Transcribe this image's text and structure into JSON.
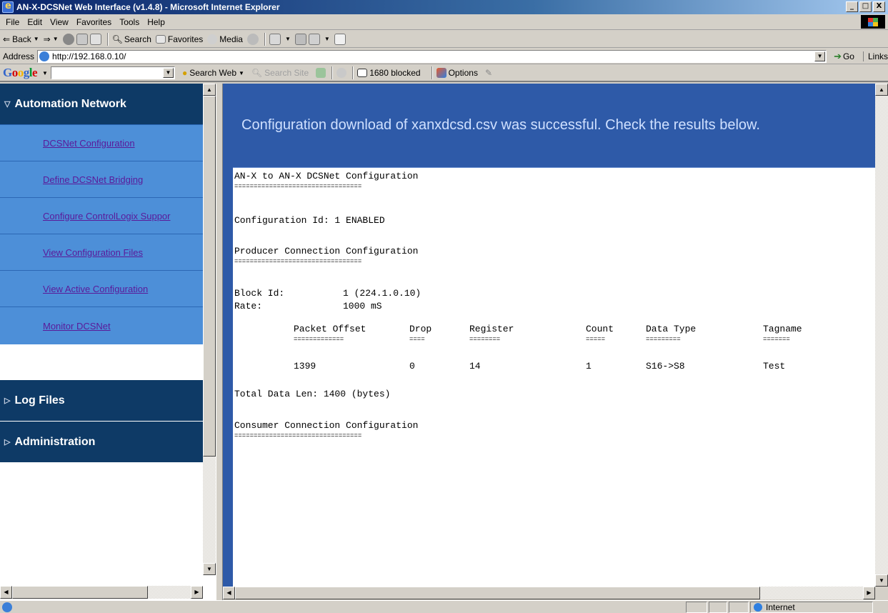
{
  "window": {
    "title": "AN-X-DCSNet Web Interface (v1.4.8) - Microsoft Internet Explorer",
    "minimize_glyph": "_",
    "restore_glyph": "□",
    "close_glyph": "X"
  },
  "menu": [
    "File",
    "Edit",
    "View",
    "Favorites",
    "Tools",
    "Help"
  ],
  "toolbar": {
    "back": "Back",
    "search": "Search",
    "favorites": "Favorites",
    "media": "Media"
  },
  "address": {
    "label": "Address",
    "url": "http://192.168.0.10/",
    "go": "Go",
    "links": "Links"
  },
  "googlebar": {
    "search_web": "Search Web",
    "search_site": "Search Site",
    "blocked": "1680 blocked",
    "options": "Options"
  },
  "sidebar": {
    "sections": [
      {
        "label": "Automation Network",
        "expanded": true
      },
      {
        "label": "Log Files",
        "expanded": false
      },
      {
        "label": "Administration",
        "expanded": false
      }
    ],
    "items": [
      {
        "label": "DCSNet Configuration"
      },
      {
        "label": "Define DCSNet Bridging"
      },
      {
        "label": "Configure ControlLogix Suppor"
      },
      {
        "label": "View Configuration Files"
      },
      {
        "label": "View Active Configuration"
      },
      {
        "label": "Monitor DCSNet"
      }
    ]
  },
  "banner": "Configuration download of xanxdcsd.csv was successful. Check the results below.",
  "results": {
    "title": "AN-X to AN-X DCSNet Configuration",
    "title_rule": "=================================",
    "config_id": "Configuration Id: 1 ENABLED",
    "producer_title": "Producer Connection Configuration",
    "producer_rule": "=================================",
    "block_id_label": "Block Id:",
    "block_id_value": "1 (224.1.0.10)",
    "rate_label": "Rate:",
    "rate_value": "1000 mS",
    "table": {
      "headers": [
        "Packet Offset",
        "Drop",
        "Register",
        "Count",
        "Data Type",
        "Tagname"
      ],
      "rules": [
        "=============",
        "====",
        "========",
        "=====",
        "=========",
        "======="
      ],
      "rows": [
        [
          "1399",
          "0",
          "14",
          "1",
          "S16->S8",
          "Test"
        ]
      ]
    },
    "total": "Total Data Len: 1400 (bytes)",
    "consumer_title": "Consumer Connection Configuration",
    "consumer_rule": "================================="
  },
  "status": {
    "zone": "Internet"
  },
  "colors": {
    "banner_bg": "#2e5aa8",
    "section_bg": "#0e3a66",
    "nav_bg": "#4d8fd8",
    "nav_link": "#5a1a9a"
  }
}
